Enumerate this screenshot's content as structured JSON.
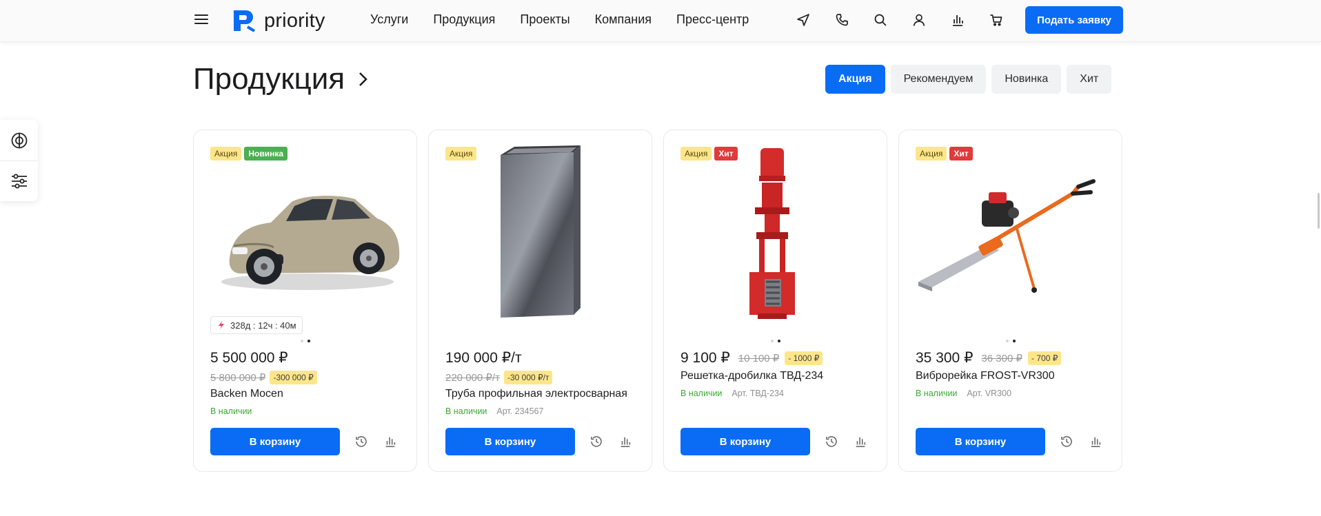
{
  "header": {
    "logo_text": "priority",
    "nav": [
      "Услуги",
      "Продукция",
      "Проекты",
      "Компания",
      "Пресс-центр"
    ],
    "cta_label": "Подать заявку",
    "icons": [
      "send-icon",
      "phone-icon",
      "search-icon",
      "user-icon",
      "compare-icon",
      "cart-icon"
    ]
  },
  "section": {
    "title": "Продукция",
    "tabs": [
      "Акция",
      "Рекомендуем",
      "Новинка",
      "Хит"
    ],
    "active_tab": "Акция"
  },
  "products": [
    {
      "badges": [
        "Акция",
        "Новинка"
      ],
      "timer": "328д : 12ч : 40м",
      "price": "5 500 000 ₽",
      "old_price": "5 800 000 ₽",
      "discount": "-300 000 ₽",
      "name": "Backen Mocen",
      "stock": "В наличии",
      "article": "",
      "cart_label": "В корзину",
      "image": "car"
    },
    {
      "badges": [
        "Акция"
      ],
      "timer": "",
      "price": "190 000 ₽/т",
      "old_price": "220 000 ₽/т",
      "discount": "-30 000 ₽/т",
      "name": "Труба профильная электросварная",
      "stock": "В наличии",
      "article": "Арт. 234567",
      "cart_label": "В корзину",
      "image": "pipe"
    },
    {
      "badges": [
        "Акция",
        "Хит"
      ],
      "timer": "",
      "price": "9 100 ₽",
      "old_price": "10 100 ₽",
      "discount": "- 1000 ₽",
      "name": "Решетка-дробилка ТВД-234",
      "stock": "В наличии",
      "article": "Арт. ТВД-234",
      "cart_label": "В корзину",
      "image": "crusher"
    },
    {
      "badges": [
        "Акция",
        "Хит"
      ],
      "timer": "",
      "price": "35 300 ₽",
      "old_price": "36 300 ₽",
      "discount": "- 700 ₽",
      "name": "Виброрейка FROST-VR300",
      "stock": "В наличии",
      "article": "Арт. VR300",
      "cart_label": "В корзину",
      "image": "screed"
    }
  ],
  "colors": {
    "accent": "#0a6cf5",
    "sale_badge": "#fde68a",
    "new_badge": "#4caf50",
    "hit_badge": "#e03a3a",
    "in_stock": "#3aa934"
  }
}
